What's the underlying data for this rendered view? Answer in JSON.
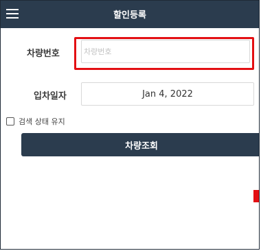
{
  "header": {
    "title": "할인등록",
    "menu_icon": "hamburger-menu-icon"
  },
  "form": {
    "plate": {
      "label": "차량번호",
      "placeholder": "차량번호",
      "value": ""
    },
    "entry_date": {
      "label": "입차일자",
      "value": "Jan 4, 2022"
    },
    "keep_search": {
      "label": "검색 상태 유지",
      "checked": false
    },
    "search_button": "차량조회"
  },
  "colors": {
    "header_bg": "#2b3c4e",
    "highlight": "#e30f13",
    "button_bg": "#2b3c4e"
  }
}
